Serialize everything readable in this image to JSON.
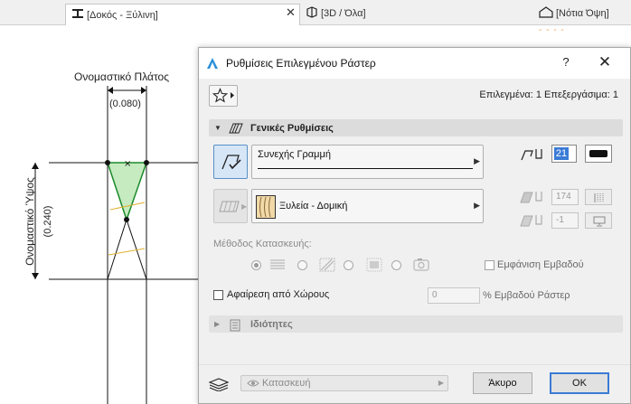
{
  "tabs": [
    {
      "label": "[Δοκός - Ξύλινη]",
      "active": true
    },
    {
      "label": "[3D / Όλα]",
      "active": false
    },
    {
      "label": "[Νότια Όψη]",
      "active": false
    }
  ],
  "tab_accent": "- - - -",
  "drawing": {
    "width_label": "Ονομαστικό Πλάτος",
    "width_value": "(0.080)",
    "height_label": "Ονομαστικό Ύψος",
    "height_value": "(0.240)"
  },
  "dialog": {
    "title": "Ρυθμίσεις Επιλεγμένου Ράστερ",
    "help": "?",
    "close": "✕",
    "selected_info": "Επιλεγμένα: 1 Επεξεργάσιμα: 1",
    "general_section": "Γενικές Ρυθμίσεις",
    "line_type": "Συνεχής Γραμμή",
    "pen_number": "21",
    "fill_type": "Ξυλεία - Δομική",
    "fill_pen": "174",
    "background_pen": "-1",
    "method_label": "Μέθοδος Κατασκευής:",
    "show_area_label": "Εμφάνιση Εμβαδού",
    "subtract_label": "Αφαίρεση από Χώρους",
    "percent_value": "0",
    "percent_label": "% Εμβαδού Ράστερ",
    "properties_section": "Ιδιότητες",
    "layer": "Κατασκευή",
    "cancel_button": "Άκυρο",
    "ok_button": "OK"
  },
  "colors": {
    "accent_blue": "#3a7bd5",
    "fill_green": "#b8e6b0",
    "outline_green": "#1a8a2a",
    "timber_fill": "#f1d9a8"
  }
}
